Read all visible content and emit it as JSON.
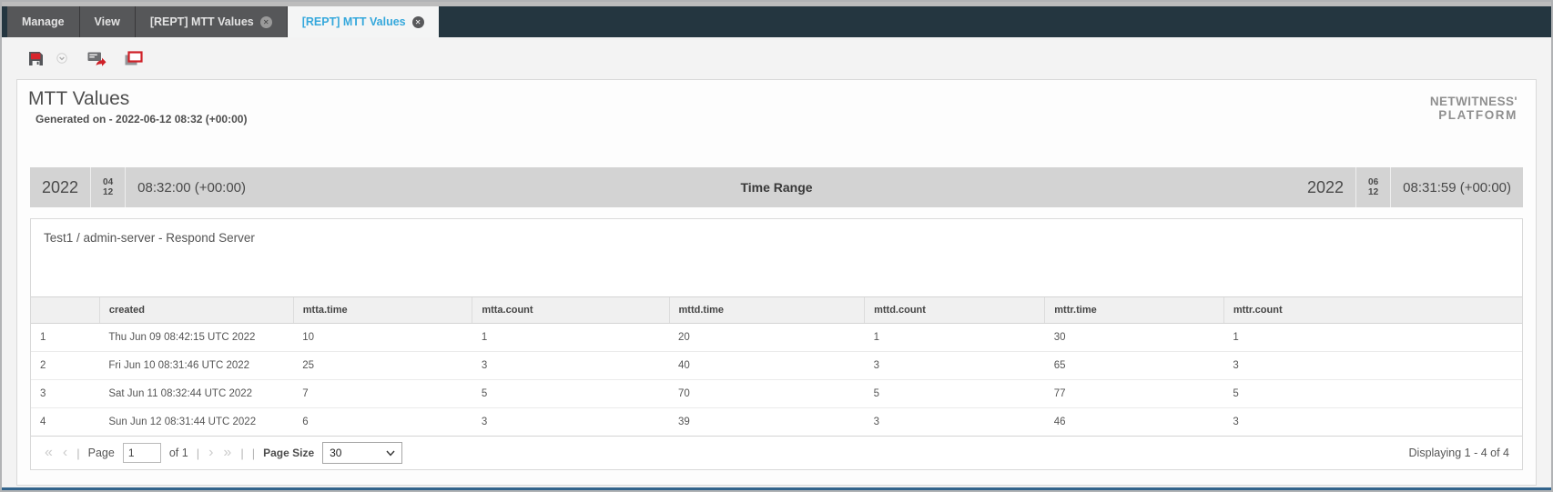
{
  "tabs": [
    {
      "label": "Manage",
      "active": false,
      "closable": false
    },
    {
      "label": "View",
      "active": false,
      "closable": false
    },
    {
      "label": "[REPT] MTT Values",
      "active": false,
      "closable": true
    },
    {
      "label": "[REPT] MTT Values",
      "active": true,
      "closable": true
    }
  ],
  "toolbar": {
    "icons": [
      "save-icon",
      "save-options-chevron-icon",
      "email-report-icon",
      "print-report-icon"
    ]
  },
  "report": {
    "title": "MTT Values",
    "generated": "Generated on - 2022-06-12 08:32 (+00:00)",
    "logo_line1": "NETWITNESS'",
    "logo_line2": "PLATFORM"
  },
  "time_range": {
    "label": "Time Range",
    "start": {
      "year": "2022",
      "month": "04",
      "day": "12",
      "time": "08:32:00 (+00:00)"
    },
    "end": {
      "year": "2022",
      "month": "06",
      "day": "12",
      "time": "08:31:59 (+00:00)"
    }
  },
  "section": {
    "title": "Test1 / admin-server - Respond Server"
  },
  "table": {
    "columns": [
      "",
      "created",
      "mtta.time",
      "mtta.count",
      "mttd.time",
      "mttd.count",
      "mttr.time",
      "mttr.count"
    ],
    "rows": [
      [
        "1",
        "Thu Jun 09 08:42:15 UTC 2022",
        "10",
        "1",
        "20",
        "1",
        "30",
        "1"
      ],
      [
        "2",
        "Fri Jun 10 08:31:46 UTC 2022",
        "25",
        "3",
        "40",
        "3",
        "65",
        "3"
      ],
      [
        "3",
        "Sat Jun 11 08:32:44 UTC 2022",
        "7",
        "5",
        "70",
        "5",
        "77",
        "5"
      ],
      [
        "4",
        "Sun Jun 12 08:31:44 UTC 2022",
        "6",
        "3",
        "39",
        "3",
        "46",
        "3"
      ]
    ]
  },
  "pagination": {
    "first_icon": "«",
    "prev_icon": "‹",
    "next_icon": "›",
    "last_icon": "»",
    "page_label": "Page",
    "page_value": "1",
    "of_label": "of 1",
    "page_size_label": "Page Size",
    "page_size_value": "30",
    "displaying": "Displaying 1 - 4 of 4"
  },
  "colors": {
    "tabbar_dark": "#243640",
    "active_tab_blue": "#35a8dc",
    "brand_red": "#cf2027",
    "time_bar_gray": "#d3d3d3",
    "bottom_line_blue": "#33648c"
  }
}
